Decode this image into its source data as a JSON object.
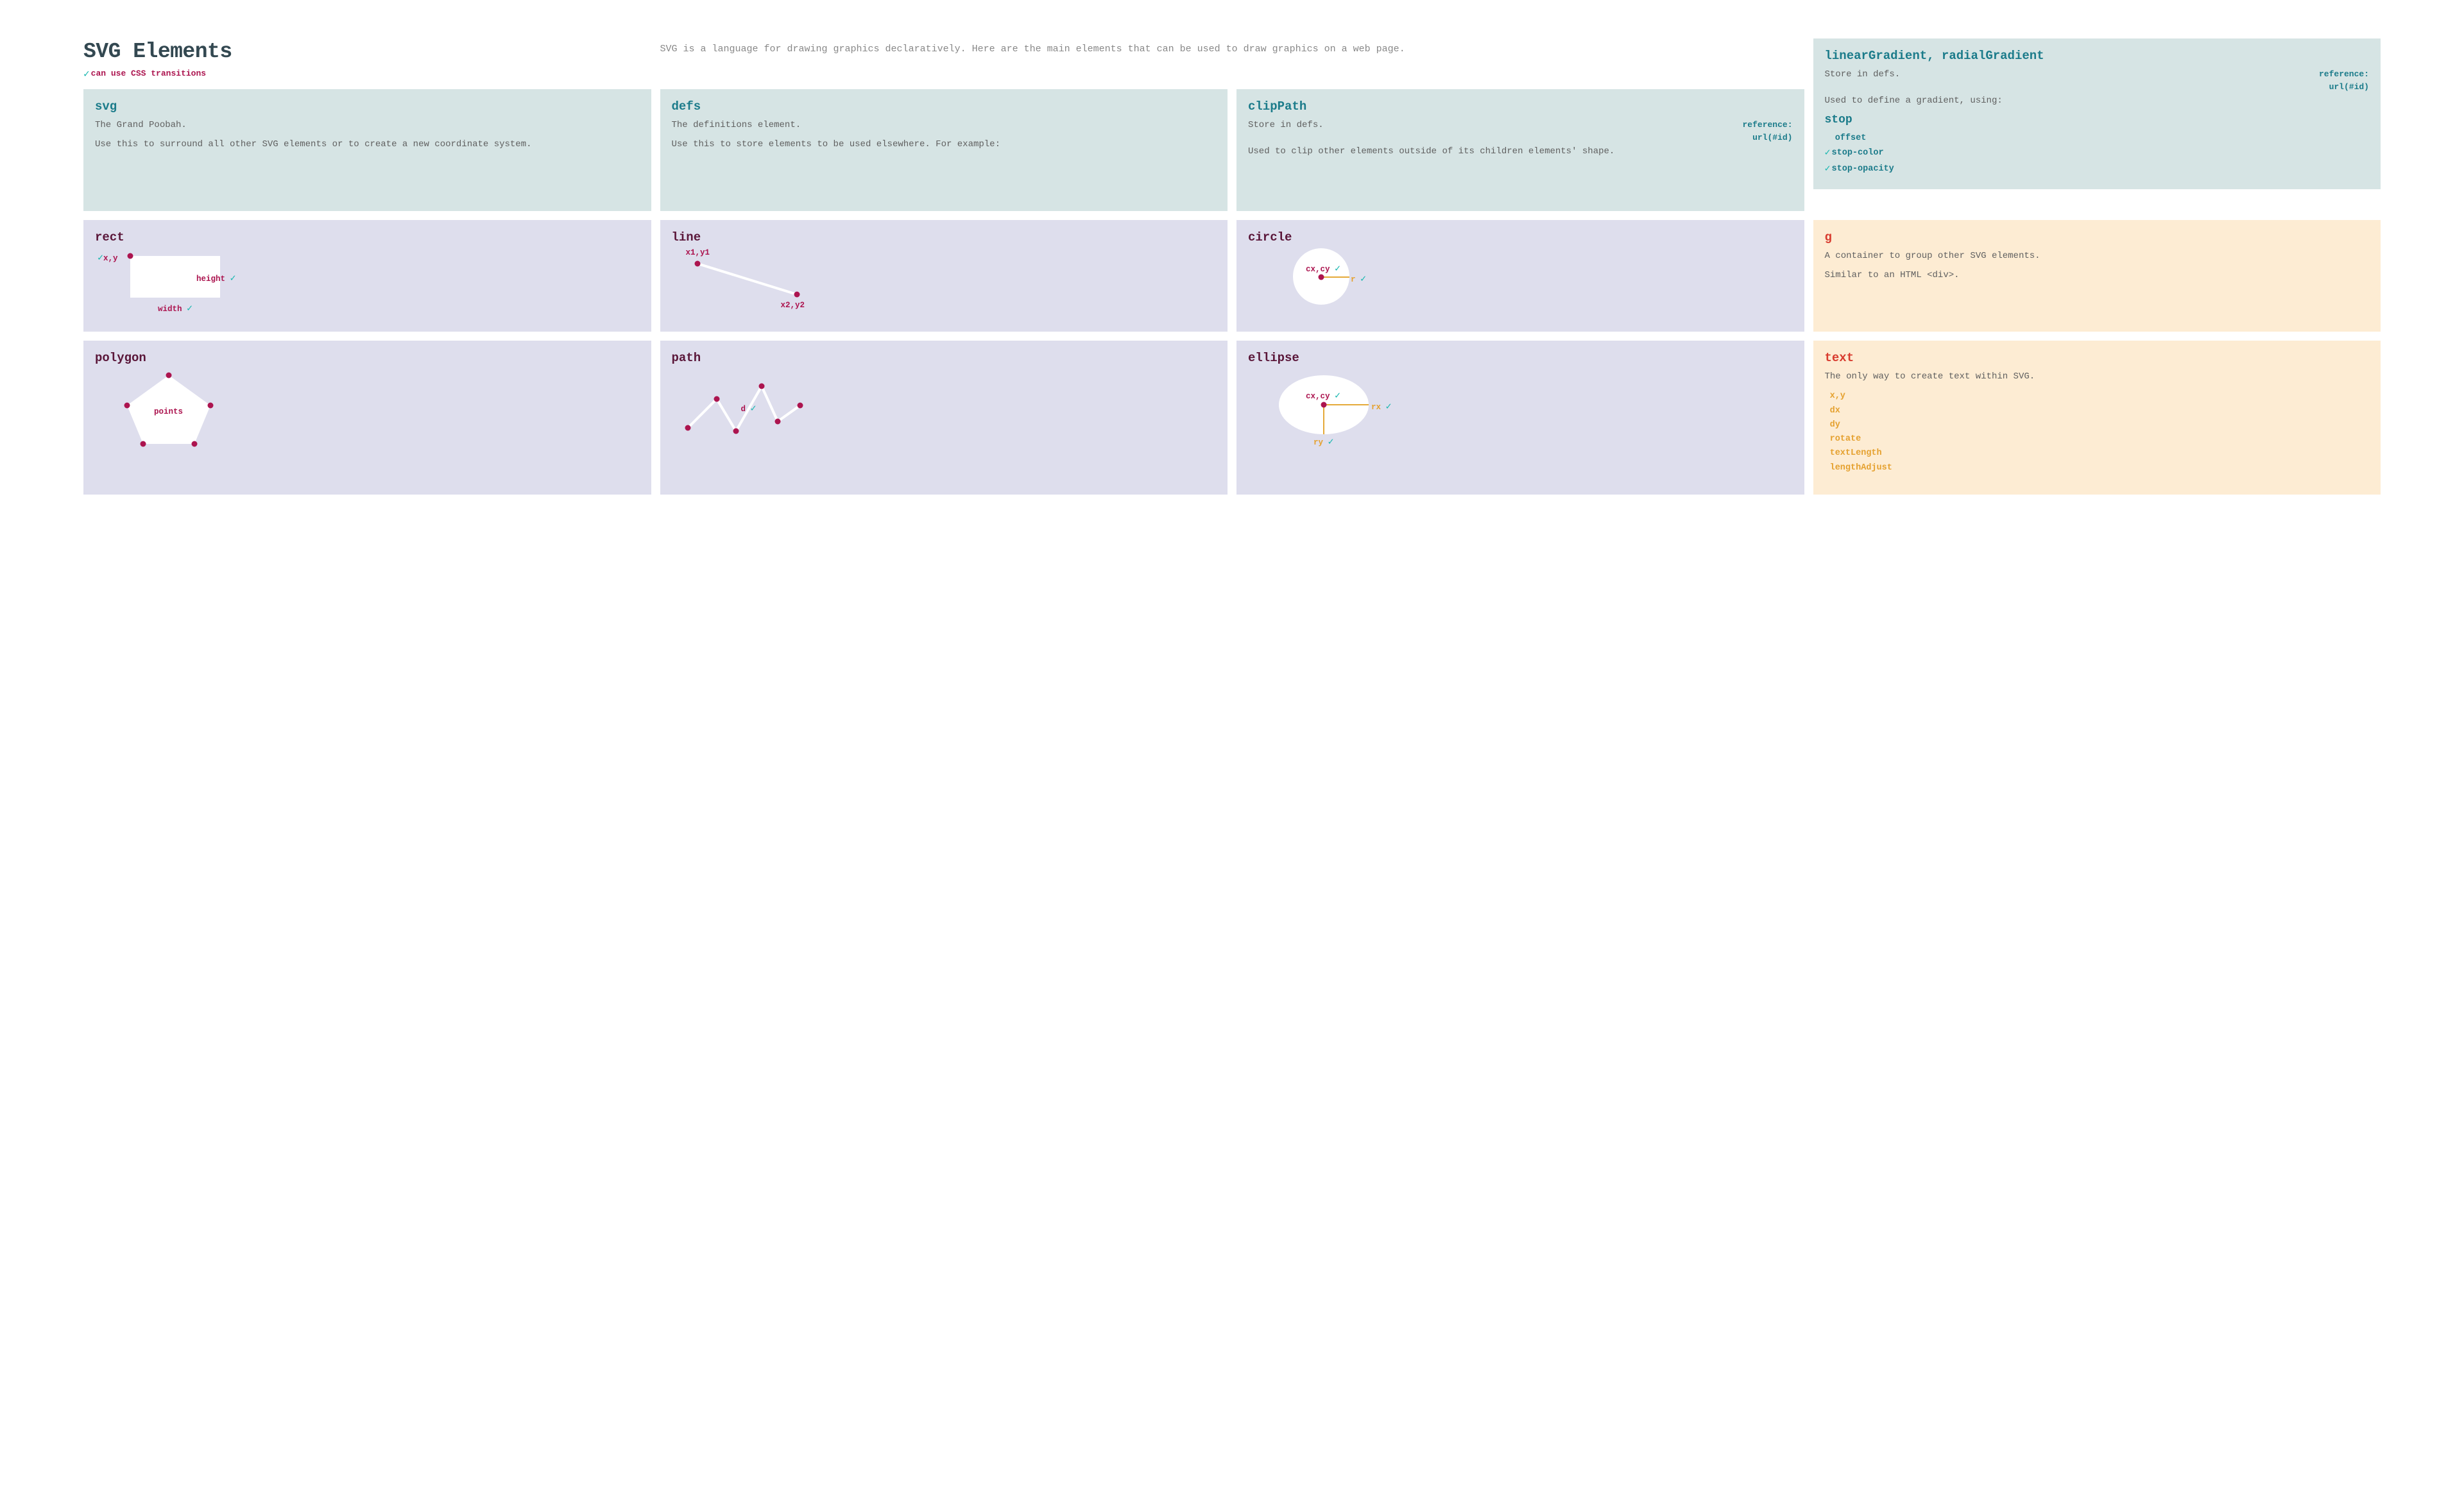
{
  "header": {
    "title": "SVG Elements",
    "legend": "can use CSS transitions",
    "subtitle": "SVG is a language for drawing graphics declaratively. Here are the main elements that can be used to draw graphics on a web page."
  },
  "cards": {
    "svg": {
      "title": "svg",
      "p1": "The Grand Poobah.",
      "p2": "Use this to surround all other SVG elements or to create a new coordinate system."
    },
    "defs": {
      "title": "defs",
      "p1": "The definitions element.",
      "p2": "Use this to store elements to be used elsewhere. For example:"
    },
    "clipPath": {
      "title": "clipPath",
      "p1": "Store in defs.",
      "ref1": "reference:",
      "ref2": "url(#id)",
      "p2": "Used to clip other elements outside of its children elements' shape."
    },
    "gradient": {
      "title": "linearGradient, radialGradient",
      "p1": "Store in defs.",
      "ref1": "reference:",
      "ref2": "url(#id)",
      "p2": "Used to define a gradient, using:",
      "sub": "stop",
      "attrs": [
        {
          "name": "offset",
          "check": false
        },
        {
          "name": "stop-color",
          "check": true
        },
        {
          "name": "stop-opacity",
          "check": true
        }
      ]
    },
    "rect": {
      "title": "rect",
      "labels": {
        "xy": "x,y",
        "height": "height",
        "width": "width"
      }
    },
    "line": {
      "title": "line",
      "labels": {
        "p1": "x1,y1",
        "p2": "x2,y2"
      }
    },
    "circle": {
      "title": "circle",
      "labels": {
        "center": "cx,cy",
        "r": "r"
      }
    },
    "g": {
      "title": "g",
      "p1": "A container to group other SVG elements.",
      "p2": "Similar to an HTML <div>."
    },
    "polygon": {
      "title": "polygon",
      "labels": {
        "points": "points"
      }
    },
    "path": {
      "title": "path",
      "labels": {
        "d": "d"
      }
    },
    "ellipse": {
      "title": "ellipse",
      "labels": {
        "center": "cx,cy",
        "rx": "rx",
        "ry": "ry"
      }
    },
    "text": {
      "title": "text",
      "p1": "The only way to create text within SVG.",
      "attrs": [
        {
          "name": "x,y"
        },
        {
          "name": "dx"
        },
        {
          "name": "dy"
        },
        {
          "name": "rotate"
        },
        {
          "name": "textLength"
        },
        {
          "name": "lengthAdjust"
        }
      ]
    }
  }
}
